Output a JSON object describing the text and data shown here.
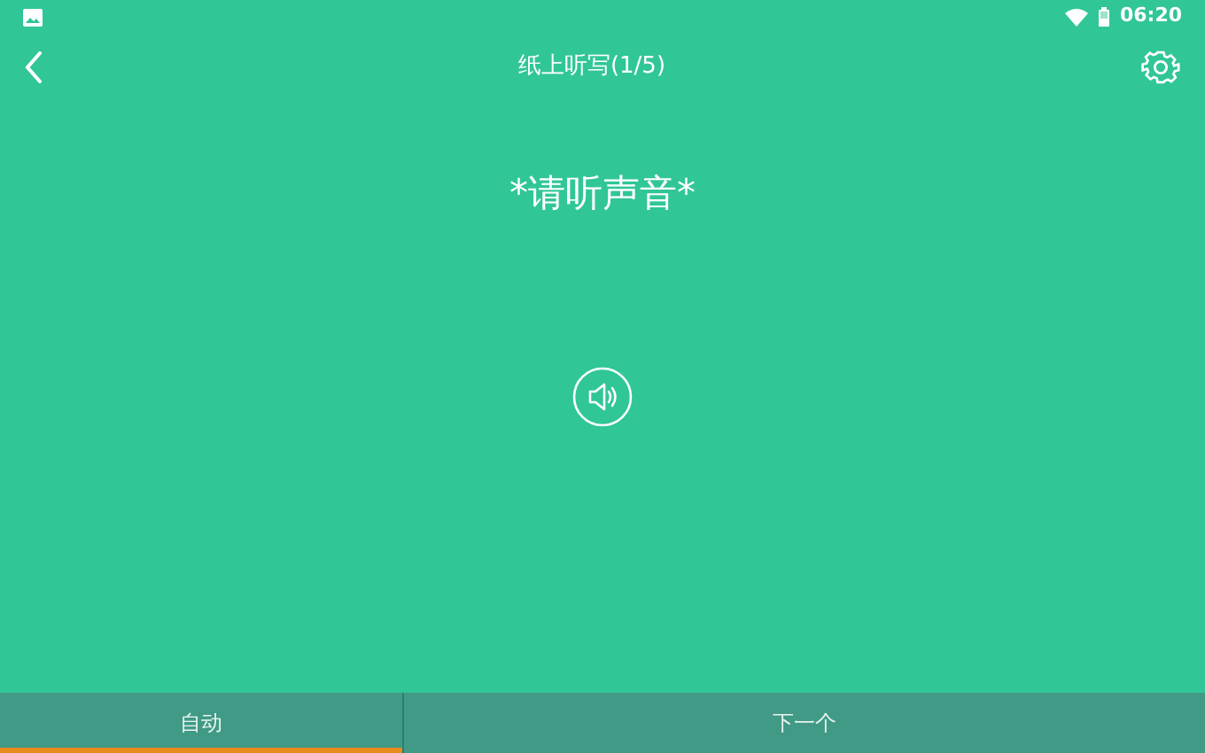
{
  "status_bar": {
    "time": "06:20"
  },
  "toolbar": {
    "title": "纸上听写(1/5)"
  },
  "prompt": "*请听声音*",
  "bottom_tabs": [
    {
      "label": "自动",
      "selected": true
    },
    {
      "label": "下一个",
      "selected": false
    }
  ]
}
